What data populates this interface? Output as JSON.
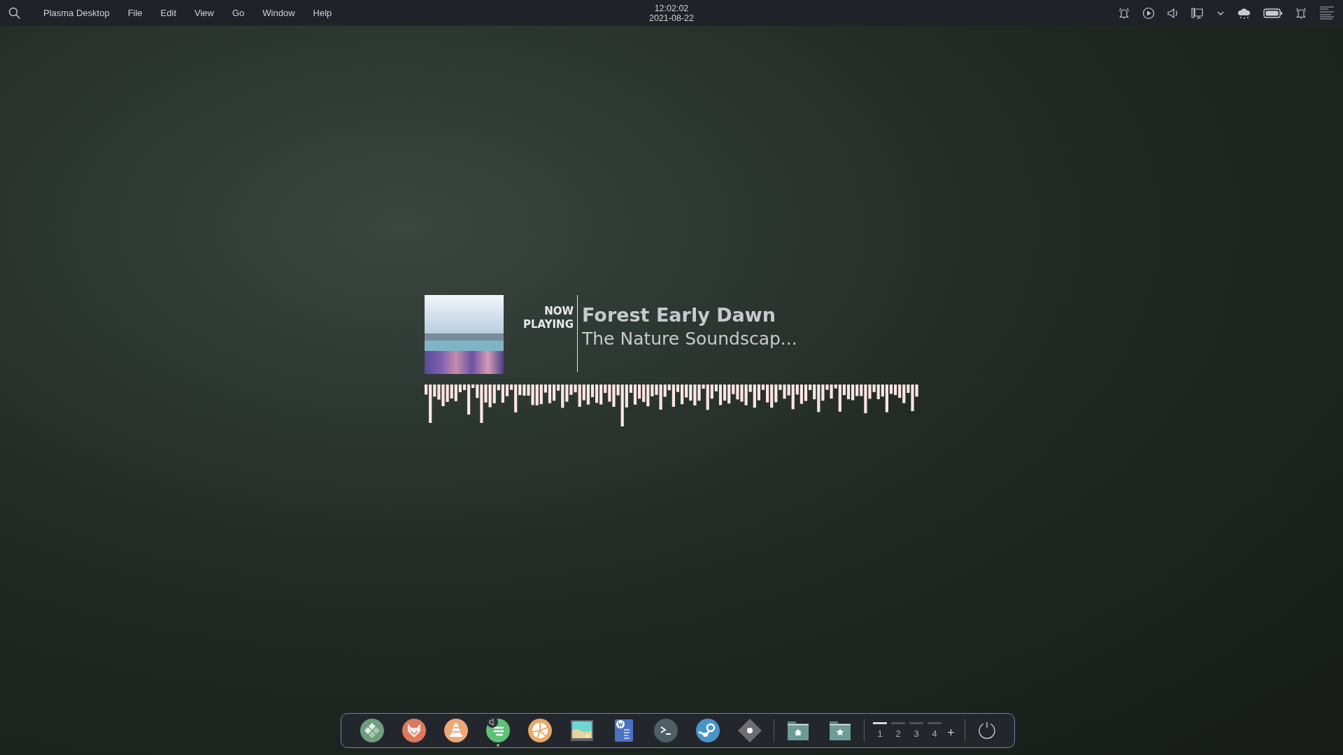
{
  "top_bar": {
    "menu": [
      "Plasma Desktop",
      "File",
      "Edit",
      "View",
      "Go",
      "Window",
      "Help"
    ],
    "clock": {
      "time": "12:02:02",
      "date": "2021-08-22"
    }
  },
  "now_playing": {
    "label_line_1": "NOW",
    "label_line_2": "PLAYING",
    "title": "Forest Early Dawn",
    "artist": "The Nature Soundscap..."
  },
  "dock": {
    "apps": [
      {
        "kind": "tiles",
        "running": false,
        "audio": false
      },
      {
        "kind": "fox",
        "running": false,
        "audio": false
      },
      {
        "kind": "cone",
        "running": false,
        "audio": false
      },
      {
        "kind": "music",
        "running": true,
        "audio": true
      },
      {
        "kind": "citrus",
        "running": false,
        "audio": false
      },
      {
        "kind": "picture",
        "running": false,
        "audio": false
      },
      {
        "kind": "document",
        "running": false,
        "audio": false
      },
      {
        "kind": "terminal",
        "running": false,
        "audio": false
      },
      {
        "kind": "steam",
        "running": false,
        "audio": false
      },
      {
        "kind": "diamond",
        "running": false,
        "audio": false
      }
    ],
    "places": [
      {
        "kind": "home"
      },
      {
        "kind": "star"
      }
    ],
    "desktops": [
      {
        "label": "1",
        "selected": true
      },
      {
        "label": "2",
        "selected": false
      },
      {
        "label": "3",
        "selected": false
      },
      {
        "label": "4",
        "selected": false
      }
    ],
    "add_desktop": "+"
  }
}
